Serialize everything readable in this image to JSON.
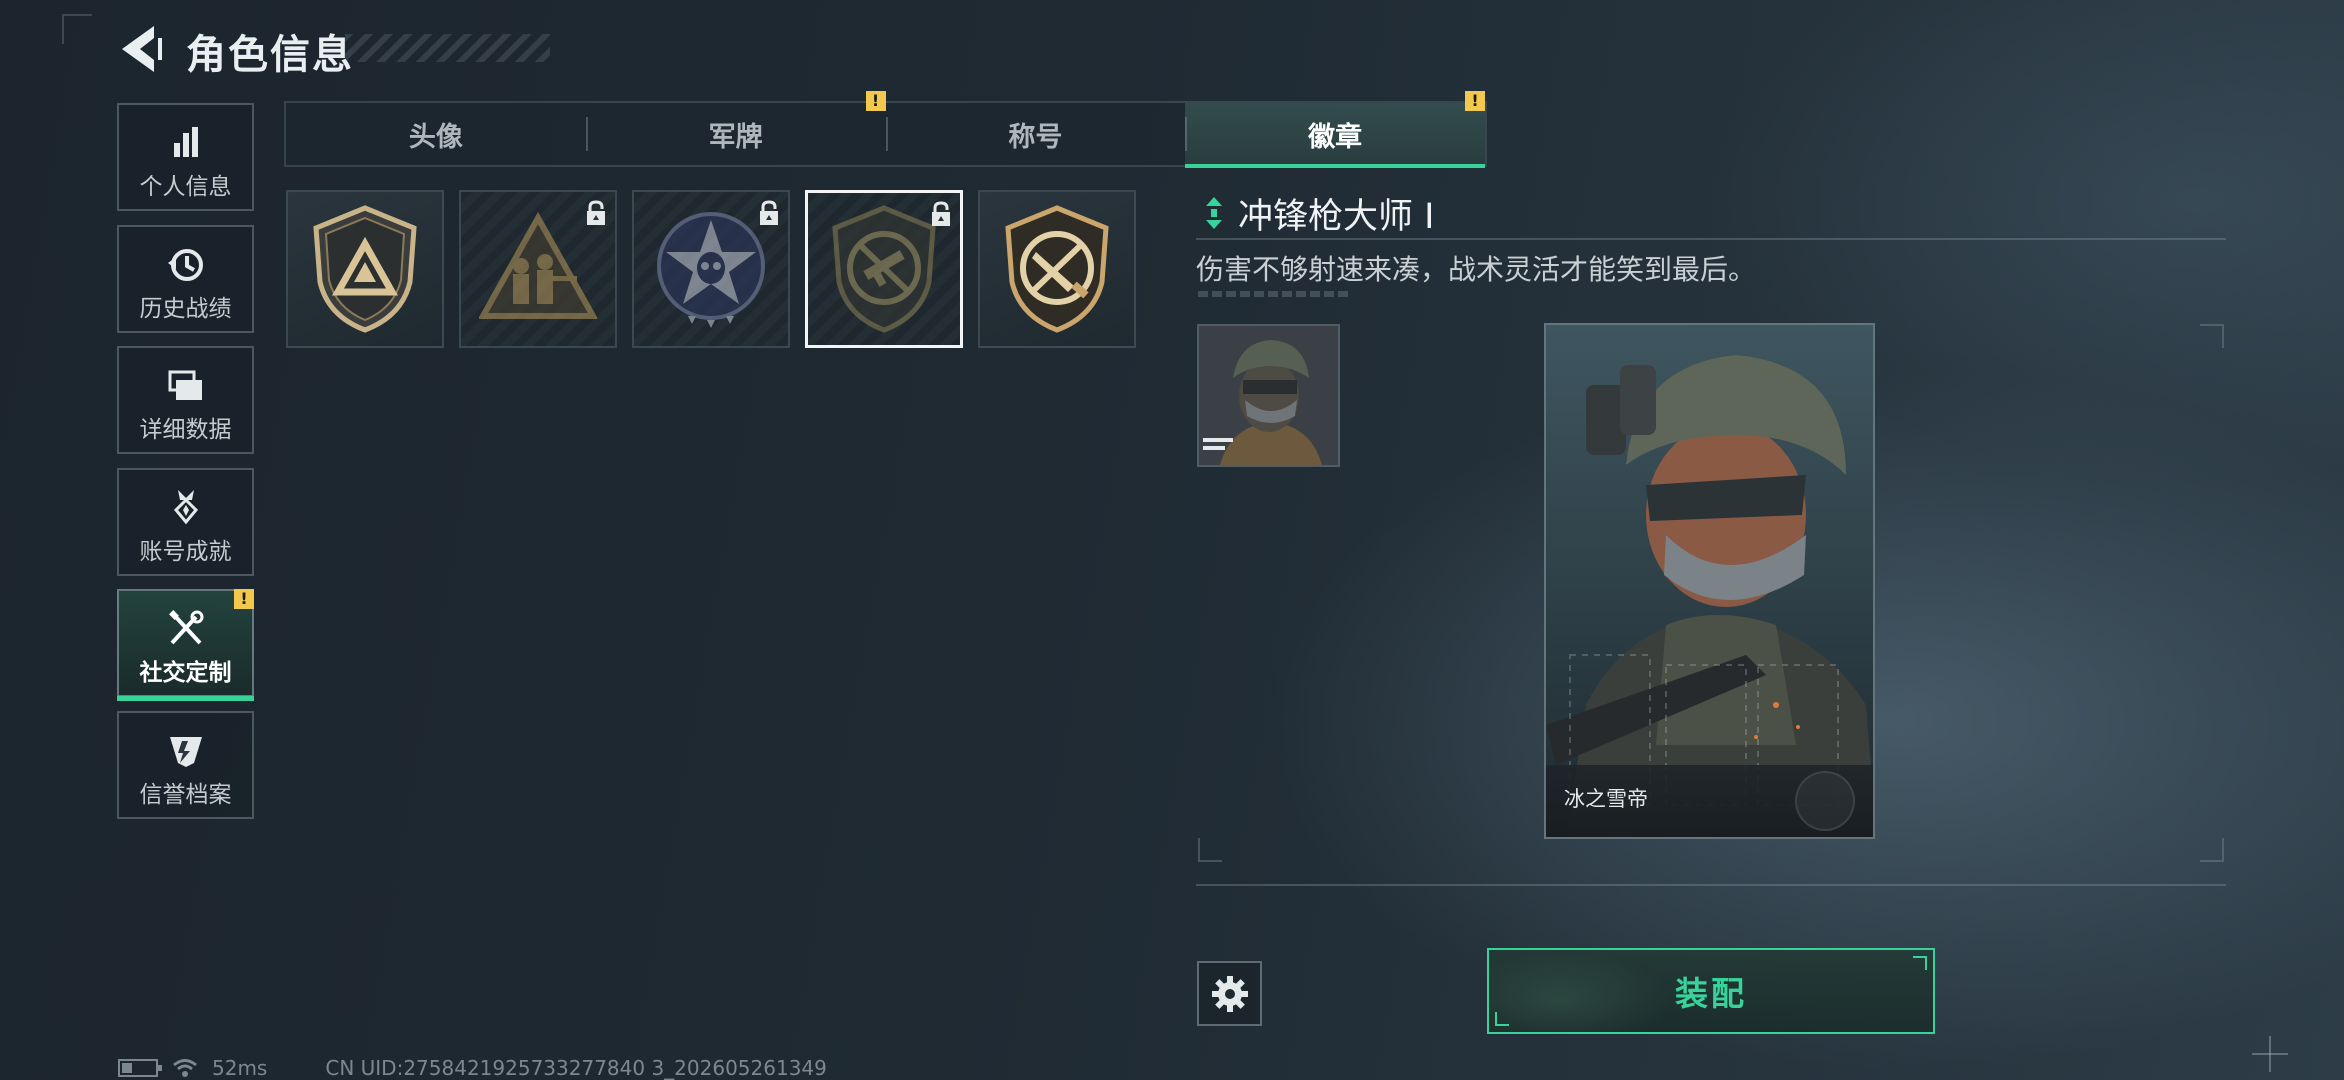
{
  "header": {
    "title": "角色信息"
  },
  "sidebar": {
    "items": [
      {
        "label": "个人信息",
        "icon": "bar-chart-icon",
        "active": false
      },
      {
        "label": "历史战绩",
        "icon": "history-clock-icon",
        "active": false
      },
      {
        "label": "详细数据",
        "icon": "folders-icon",
        "active": false
      },
      {
        "label": "账号成就",
        "icon": "medal-icon",
        "active": false
      },
      {
        "label": "社交定制",
        "icon": "tools-icon",
        "active": true,
        "alert": "!"
      },
      {
        "label": "信誉档案",
        "icon": "credit-emblem-icon",
        "active": false
      }
    ]
  },
  "tabs": [
    {
      "label": "头像",
      "active": false
    },
    {
      "label": "军牌",
      "active": false,
      "alert": "!"
    },
    {
      "label": "称号",
      "active": false
    },
    {
      "label": "徽章",
      "active": true,
      "alert": "!"
    }
  ],
  "badges": [
    {
      "name": "triangle-shield-badge",
      "locked": false,
      "selected": false
    },
    {
      "name": "squad-triangle-badge",
      "locked": true,
      "selected": false
    },
    {
      "name": "star-skull-badge",
      "locked": true,
      "selected": false
    },
    {
      "name": "smg-master-badge",
      "locked": true,
      "selected": true
    },
    {
      "name": "knife-shield-badge",
      "locked": false,
      "selected": false
    }
  ],
  "detail": {
    "title": "冲锋枪大师 I",
    "description": "伤害不够射速来凑，战术灵活才能笑到最后。",
    "card_name": "冰之雪帝"
  },
  "actions": {
    "equip_label": "装配"
  },
  "status": {
    "ping": "52ms",
    "uid": "CN UID:2758421925733277840 3_202605261349"
  },
  "colors": {
    "accent": "#37d39a",
    "alert": "#f2c94c",
    "background": "#1f2a33"
  }
}
